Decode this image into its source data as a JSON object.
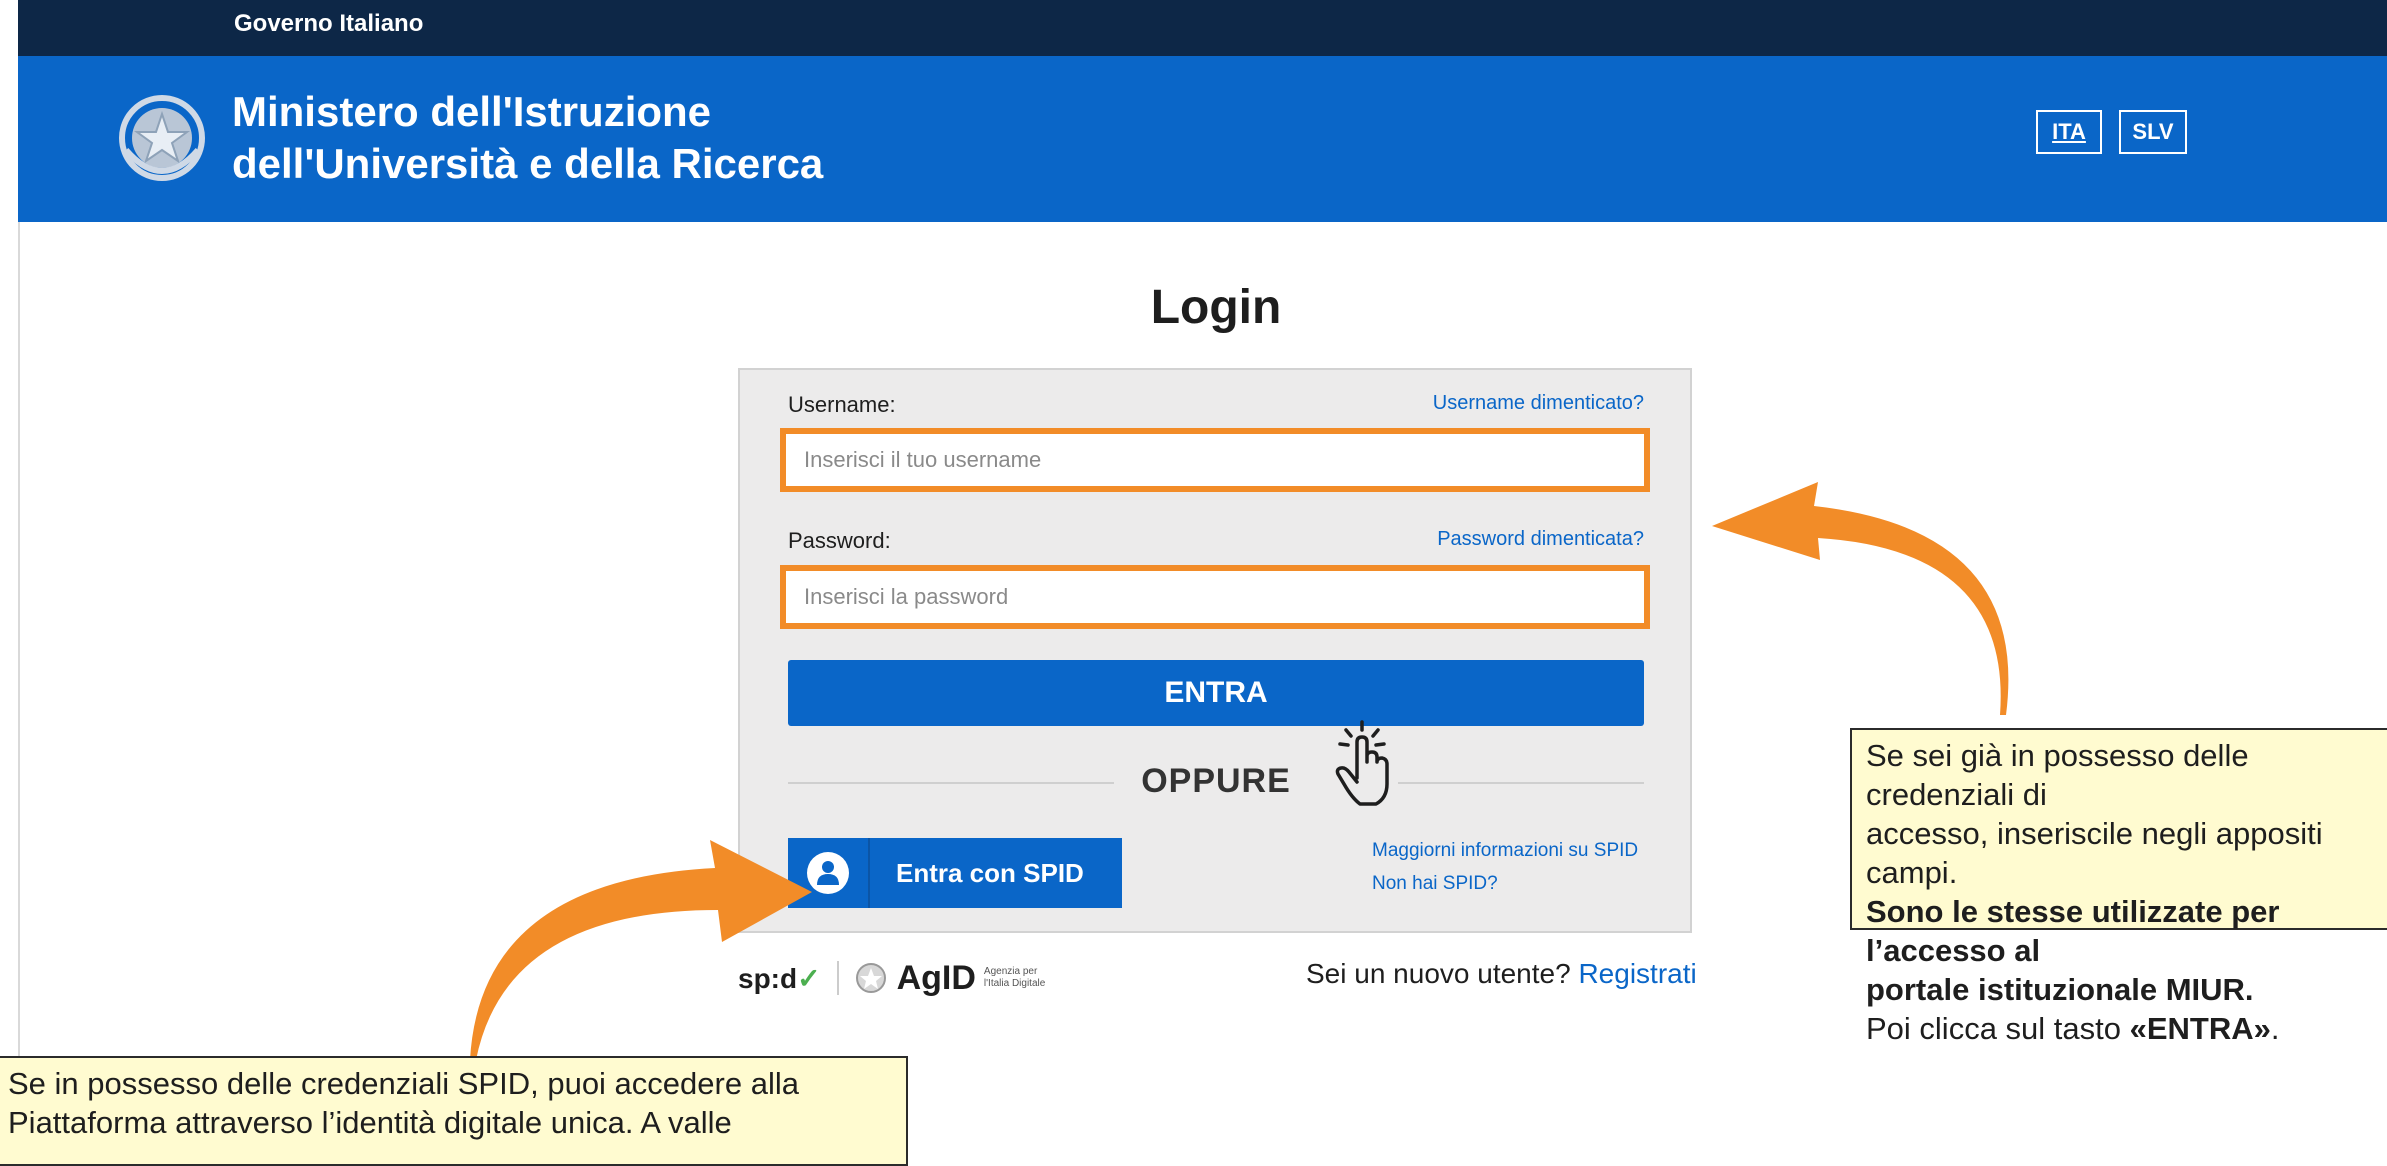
{
  "gov_bar": {
    "label": "Governo Italiano"
  },
  "header": {
    "ministry_line1": "Ministero dell'Istruzione",
    "ministry_line2": "dell'Università e della Ricerca",
    "languages": [
      "ITA",
      "SLV"
    ]
  },
  "login": {
    "title": "Login",
    "username_label": "Username:",
    "username_forgot": "Username dimenticato?",
    "username_placeholder": "Inserisci il tuo username",
    "password_label": "Password:",
    "password_forgot": "Password dimenticata?",
    "password_placeholder": "Inserisci la password",
    "submit_label": "ENTRA",
    "or_label": "OPPURE",
    "spid_button_label": "Entra con SPID",
    "spid_more_info": "Maggiorni informazioni su SPID",
    "spid_no_spid": "Non hai SPID?"
  },
  "footer": {
    "spid_logo_text": "sp:d",
    "agid_text": "AgID",
    "agid_sub": "Agenzia per l'Italia Digitale",
    "new_user_prompt": "Sei un nuovo utente?",
    "register_link": "Registrati"
  },
  "notes": {
    "right_line1": "Se sei già in possesso delle credenziali di",
    "right_line2": "accesso, inseriscile negli appositi campi.",
    "right_bold_1": "Sono le stesse utilizzate per l’accesso al",
    "right_bold_2": "portale istituzionale MIUR.",
    "right_line5_prefix": "Poi clicca sul tasto ",
    "right_line5_bold": "«ENTRA»",
    "right_line5_suffix": ".",
    "left_line1": "Se in possesso delle credenziali SPID, puoi accedere alla",
    "left_line2": "Piattaforma attraverso l’identità digitale unica. A valle"
  },
  "colors": {
    "gov_bar": "#0d2747",
    "header_blue": "#0a66c8",
    "highlight_orange": "#f28c28",
    "note_background": "#fffbd0"
  }
}
